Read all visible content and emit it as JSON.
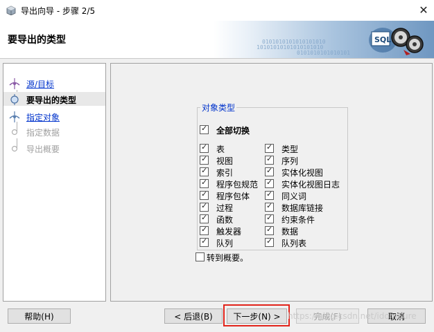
{
  "window": {
    "title": "导出向导 - 步骤 2/5",
    "close_glyph": "✕"
  },
  "banner": {
    "title": "要导出的类型",
    "art_text": "SQL",
    "binary_rows": [
      "0101010101010101010",
      "10101010101010101010",
      "0101010101010101"
    ]
  },
  "steps": [
    {
      "label": "源/目标",
      "state": "link"
    },
    {
      "label": "要导出的类型",
      "state": "current"
    },
    {
      "label": "指定对象",
      "state": "link"
    },
    {
      "label": "指定数据",
      "state": "disabled"
    },
    {
      "label": "导出概要",
      "state": "disabled"
    }
  ],
  "object_types": {
    "legend": "对象类型",
    "toggle_all": {
      "label": "全部切换",
      "checked": true
    },
    "left_column": [
      {
        "label": "表",
        "checked": true
      },
      {
        "label": "视图",
        "checked": true
      },
      {
        "label": "索引",
        "checked": true
      },
      {
        "label": "程序包规范",
        "checked": true
      },
      {
        "label": "程序包体",
        "checked": true
      },
      {
        "label": "过程",
        "checked": true
      },
      {
        "label": "函数",
        "checked": true
      },
      {
        "label": "触发器",
        "checked": true
      },
      {
        "label": "队列",
        "checked": true
      }
    ],
    "right_column": [
      {
        "label": "类型",
        "checked": true
      },
      {
        "label": "序列",
        "checked": true
      },
      {
        "label": "实体化视图",
        "checked": true
      },
      {
        "label": "实体化视图日志",
        "checked": true
      },
      {
        "label": "同义词",
        "checked": true
      },
      {
        "label": "数据库链接",
        "checked": true
      },
      {
        "label": "约束条件",
        "checked": true
      },
      {
        "label": "数据",
        "checked": true
      },
      {
        "label": "队列表",
        "checked": true
      }
    ],
    "go_to_summary": {
      "label": "转到概要。",
      "checked": false
    }
  },
  "buttons": {
    "help": "帮助(H)",
    "back": "< 后退(B)",
    "next": "下一步(N) >",
    "finish": "完成(F)",
    "cancel": "取消"
  },
  "watermark": "https://blog.csdn.net/idomSure",
  "colors": {
    "link": "#0033cc",
    "highlight": "#e2231a",
    "banner_gradient_end": "#6f97c1"
  }
}
